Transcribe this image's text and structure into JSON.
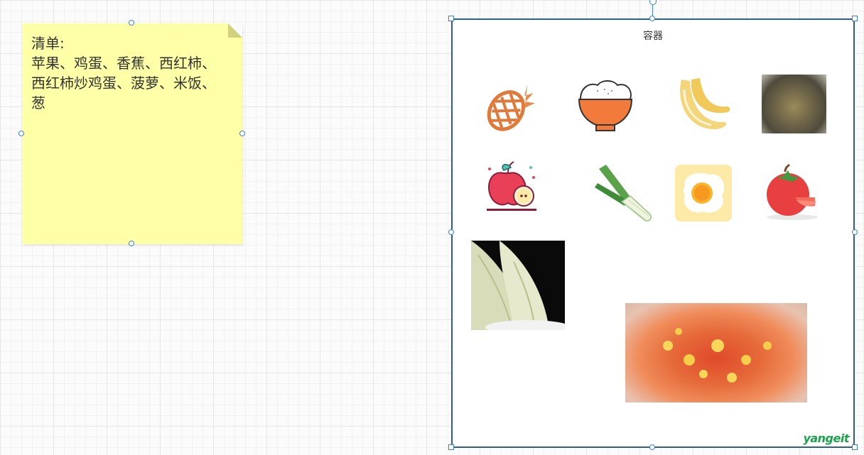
{
  "note": {
    "text": "清单:\n苹果、鸡蛋、香蕉、西红柿、西红柿炒鸡蛋、菠萝、米饭、葱"
  },
  "container": {
    "title": "容器",
    "items": [
      "pineapple-icon",
      "rice-bowl-icon",
      "banana-icon",
      "abalone-photo",
      "apple-icon",
      "scallion-icon",
      "fried-egg-icon",
      "tomato-icon",
      "bamboo-shoot-photo",
      "tomato-egg-photo"
    ]
  },
  "watermark": "yangeit",
  "colors": {
    "note_bg": "#ffffa8",
    "container_border": "#2e5f8a",
    "handle": "#3d7fd8"
  }
}
